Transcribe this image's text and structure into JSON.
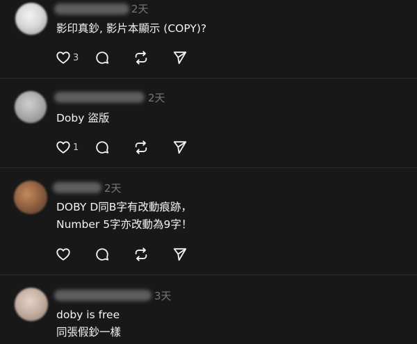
{
  "posts": [
    {
      "time": "2天",
      "lines": [
        "影印真鈔, 影片本顯示 (COPY)?"
      ],
      "likes": "3"
    },
    {
      "time": "2天",
      "lines": [
        "Doby 盜版"
      ],
      "likes": "1"
    },
    {
      "time": "2天",
      "lines": [
        "DOBY D同B字有改動痕跡，",
        "Number 5字亦改動為9字！"
      ],
      "likes": ""
    },
    {
      "time": "3天",
      "lines": [
        "doby is free",
        "同張假鈔一樣"
      ],
      "likes": ""
    }
  ],
  "icons": {
    "like": "heart-icon",
    "reply": "comment-icon",
    "repost": "repost-icon",
    "share": "send-icon"
  }
}
